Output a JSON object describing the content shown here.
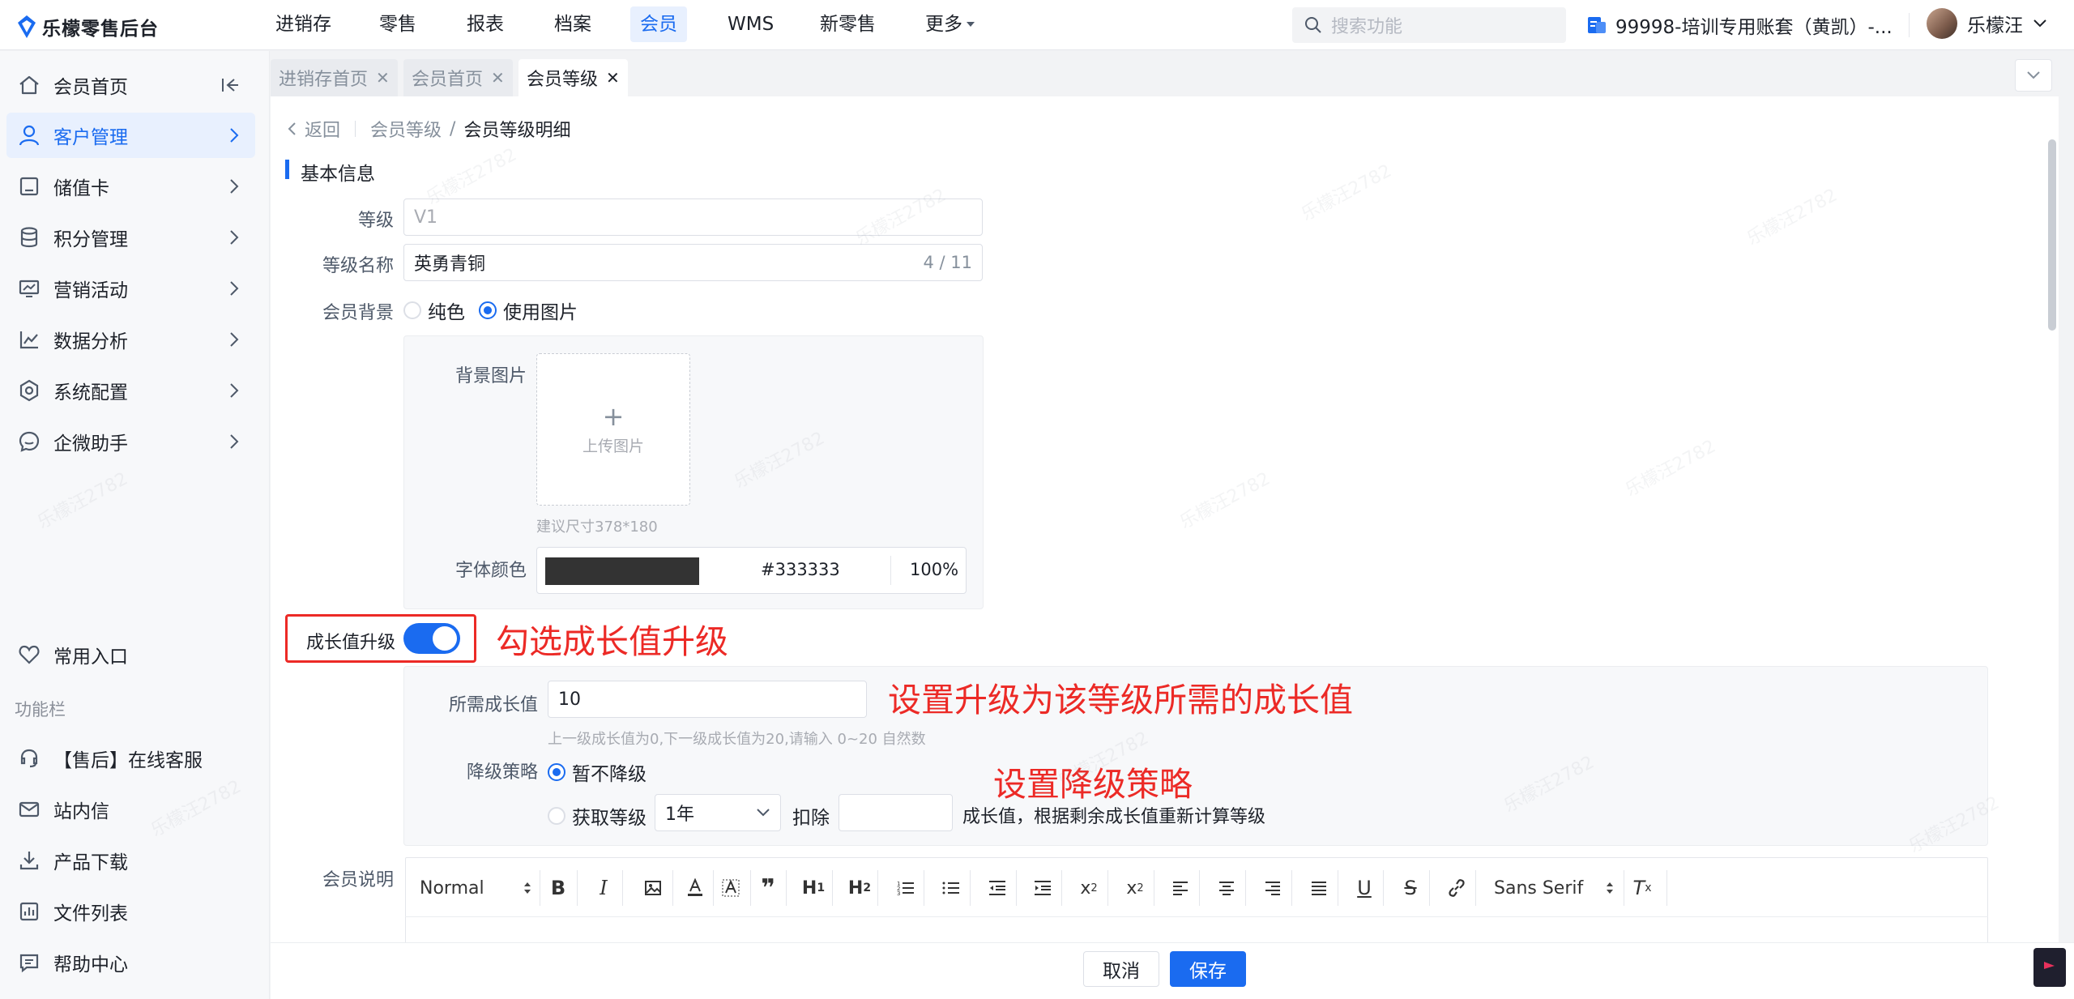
{
  "app": {
    "name": "乐檬零售后台"
  },
  "topnav": [
    {
      "label": "进销存"
    },
    {
      "label": "零售"
    },
    {
      "label": "报表"
    },
    {
      "label": "档案"
    },
    {
      "label": "会员"
    },
    {
      "label": "WMS"
    },
    {
      "label": "新零售"
    },
    {
      "label": "更多"
    }
  ],
  "search": {
    "placeholder": "搜索功能"
  },
  "account": {
    "label": "99998-培训专用账套（黄凯）-..."
  },
  "user": {
    "name": "乐檬汪"
  },
  "sidebar": {
    "items": [
      {
        "label": "会员首页"
      },
      {
        "label": "客户管理"
      },
      {
        "label": "储值卡"
      },
      {
        "label": "积分管理"
      },
      {
        "label": "营销活动"
      },
      {
        "label": "数据分析"
      },
      {
        "label": "系统配置"
      },
      {
        "label": "企微助手"
      }
    ],
    "favorites": {
      "label": "常用入口"
    },
    "function_caption": "功能栏",
    "bottom_items": [
      {
        "label": "【售后】在线客服"
      },
      {
        "label": "站内信"
      },
      {
        "label": "产品下载"
      },
      {
        "label": "文件列表"
      },
      {
        "label": "帮助中心"
      }
    ]
  },
  "tabs": [
    {
      "label": "进销存首页"
    },
    {
      "label": "会员首页"
    },
    {
      "label": "会员等级"
    }
  ],
  "breadcrumb": {
    "back": "返回",
    "parent": "会员等级",
    "separator": "/",
    "current": "会员等级明细"
  },
  "section": {
    "title": "基本信息"
  },
  "form": {
    "level": {
      "label": "等级",
      "placeholder": "V1"
    },
    "level_name": {
      "label": "等级名称",
      "value": "英勇青铜",
      "count": "4 / 11"
    },
    "background": {
      "label": "会员背景",
      "option_solid": "纯色",
      "option_image": "使用图片",
      "selected": "使用图片"
    },
    "bg_image": {
      "label": "背景图片",
      "upload_plus": "+",
      "upload_text": "上传图片",
      "hint": "建议尺寸378*180"
    },
    "font_color": {
      "label": "字体颜色",
      "swatch": "#333333",
      "hex": "#333333",
      "opacity": "100%"
    },
    "growth_upgrade": {
      "label": "成长值升级",
      "enabled": true
    },
    "required_growth": {
      "label": "所需成长值",
      "value": "10",
      "hint": "上一级成长值为0,下一级成长值为20,请输入 0~20 自然数"
    },
    "downgrade": {
      "label": "降级策略",
      "option_none": "暂不降级",
      "option_obtain": "获取等级",
      "period": "1年",
      "deduct_label": "扣除",
      "deduct_value": "",
      "suffix": "成长值，根据剩余成长值重新计算等级",
      "selected": "暂不降级"
    },
    "description": {
      "label": "会员说明"
    }
  },
  "editor_toolbar": {
    "format": "Normal",
    "font": "Sans Serif",
    "buttons": [
      "bold",
      "italic",
      "image",
      "font-color",
      "background-color",
      "blockquote",
      "h1",
      "h2",
      "ordered-list",
      "bullet-list",
      "outdent",
      "indent",
      "subscript",
      "superscript",
      "align-left",
      "align-center",
      "align-right",
      "justify",
      "underline",
      "strike",
      "link",
      "clean"
    ]
  },
  "annotations": {
    "toggle": "勾选成长值升级",
    "growth": "设置升级为该等级所需的成长值",
    "downgrade": "设置降级策略"
  },
  "footer": {
    "cancel": "取消",
    "save": "保存"
  },
  "watermark": "乐檬汪2782",
  "colors": {
    "primary": "#1a6bf0",
    "annotation": "#ec2a26"
  }
}
